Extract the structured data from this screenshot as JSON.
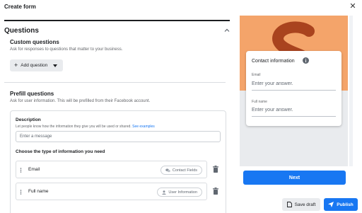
{
  "window": {
    "title": "Create form",
    "close_icon": "close-icon"
  },
  "questions": {
    "section_title": "Questions",
    "custom": {
      "title": "Custom questions",
      "subtitle": "Ask for responses to questions that matter to your business.",
      "add_button": "Add question"
    },
    "prefill": {
      "title": "Prefill questions",
      "subtitle": "Ask for user information. This will be prefilled from their Facebook account.",
      "description_label": "Description",
      "description_help": "Let people know how the information they give you will be used or shared.",
      "see_examples": "See examples",
      "message_placeholder": "Enter a message",
      "choose_label": "Choose the type of information you need",
      "fields": [
        {
          "label": "Email",
          "tag": "Contact Fields",
          "tag_icon": "chat-bubbles-icon"
        },
        {
          "label": "Full name",
          "tag": "User Information",
          "tag_icon": "person-icon"
        }
      ]
    }
  },
  "preview": {
    "card_title": "Contact information",
    "fields": [
      {
        "label": "Email",
        "placeholder": "Enter your answer."
      },
      {
        "label": "Full name",
        "placeholder": "Enter your answer."
      }
    ],
    "next_button": "Next",
    "colors": {
      "cover": "#f4a46a",
      "cover_letter": "#a9431e",
      "background": "#e9ebee"
    }
  },
  "footer": {
    "save_draft": "Save draft",
    "publish": "Publish"
  },
  "colors": {
    "accent": "#1877f2",
    "button_grey": "#e9ebee",
    "text": "#1c1e21",
    "muted": "#65676b"
  }
}
